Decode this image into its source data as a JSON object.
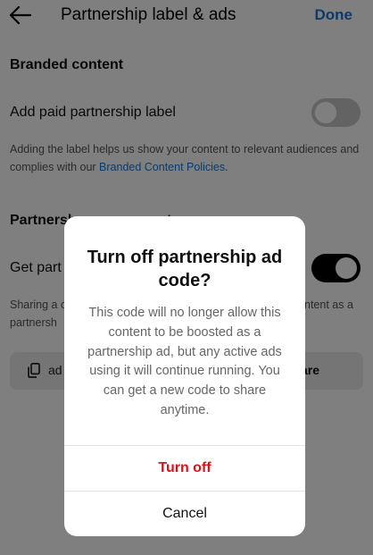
{
  "header": {
    "title": "Partnership label & ads",
    "done_label": "Done"
  },
  "branded": {
    "heading": "Branded content",
    "paid_label": "Add paid partnership label",
    "paid_toggle_on": false,
    "desc_text": "Adding the label helps us show your content to relevant audiences and complies with our ",
    "desc_link": "Branded Content Policies",
    "desc_end": "."
  },
  "partnership_ads": {
    "heading_visible": "Partnersh",
    "heading_right_fragment": "t",
    "row_label_visible": "Get part",
    "toggle_on": true,
    "desc_line1_left": "Sharing a c",
    "desc_line1_right": "ntent as a",
    "desc_line2_left": "partnersh",
    "code_visible": "ad",
    "share_visible": "are"
  },
  "dialog": {
    "title": "Turn off partnership ad code?",
    "body": "This code will no longer allow this content to be boosted as a partnership ad, but any active ads using it will continue running. You can get a new code to share anytime.",
    "confirm_label": "Turn off",
    "cancel_label": "Cancel"
  },
  "colors": {
    "accent": "#1877d6",
    "danger": "#e0101b",
    "toggle_on": "#000000",
    "toggle_off": "#c7c7c7"
  },
  "icons": {
    "back": "arrow-left",
    "copy": "copy"
  }
}
